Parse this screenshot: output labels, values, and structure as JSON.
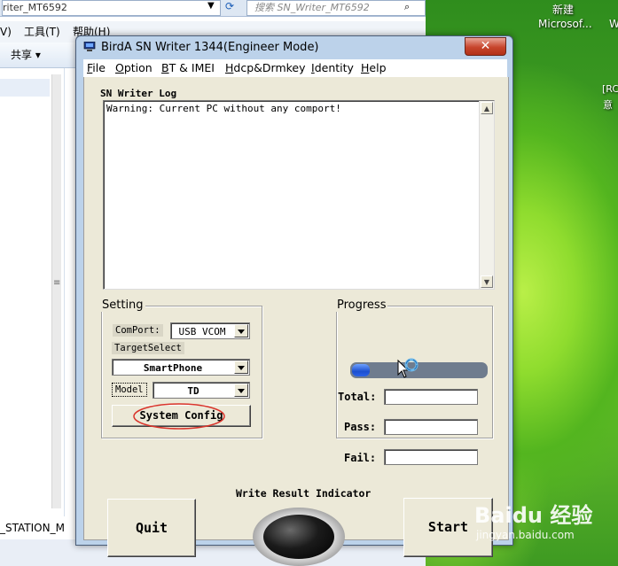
{
  "explorer": {
    "path_text": "riter_MT6592",
    "search_placeholder": "搜索 SN_Writer_MT6592",
    "menu": [
      "V)",
      "工具(T)",
      "帮助(H)"
    ],
    "toolbar_share": "共享 ▾",
    "bottom_item": "_STATION_M"
  },
  "desktop": {
    "icon_label_1": "新建",
    "icon_label_2": "Microsof...",
    "icon_label_3": "W",
    "side_text_1": "[RC",
    "side_text_2": "意"
  },
  "dialog": {
    "title": "BirdA SN Writer 1344(Engineer Mode)",
    "close_symbol": "✕",
    "menu": [
      {
        "pre": "",
        "u": "F",
        "post": "ile"
      },
      {
        "pre": "",
        "u": "O",
        "post": "ption"
      },
      {
        "pre": "",
        "u": "B",
        "post": "T & IMEI"
      },
      {
        "pre": "",
        "u": "H",
        "post": "dcp&Drmkey"
      },
      {
        "pre": "",
        "u": "I",
        "post": "dentity"
      },
      {
        "pre": "",
        "u": "H",
        "post": "elp"
      }
    ],
    "log_label": "SN Writer Log",
    "log_text": "Warning: Current PC without any comport!",
    "setting": {
      "caption": "Setting",
      "comport_label": "ComPort:",
      "comport_value": "USB VCOM",
      "target_label": "TargetSelect",
      "target_value": "SmartPhone",
      "model_label": "Model",
      "model_value": "TD",
      "system_config_label": "System Config"
    },
    "progress": {
      "caption": "Progress",
      "fill_fraction": 0.13,
      "total_label": "Total:",
      "pass_label": "Pass:",
      "fail_label": "Fail:"
    },
    "indicator_label": "Write Result Indicator",
    "quit_label": "Quit",
    "start_label": "Start"
  },
  "watermark": {
    "main": "Baidu 经验",
    "sub": "jingyan.baidu.com"
  },
  "colors": {
    "progress_fill": "#2a62e8",
    "close_button": "#c7442c",
    "annotation_circle": "#d9342b"
  }
}
